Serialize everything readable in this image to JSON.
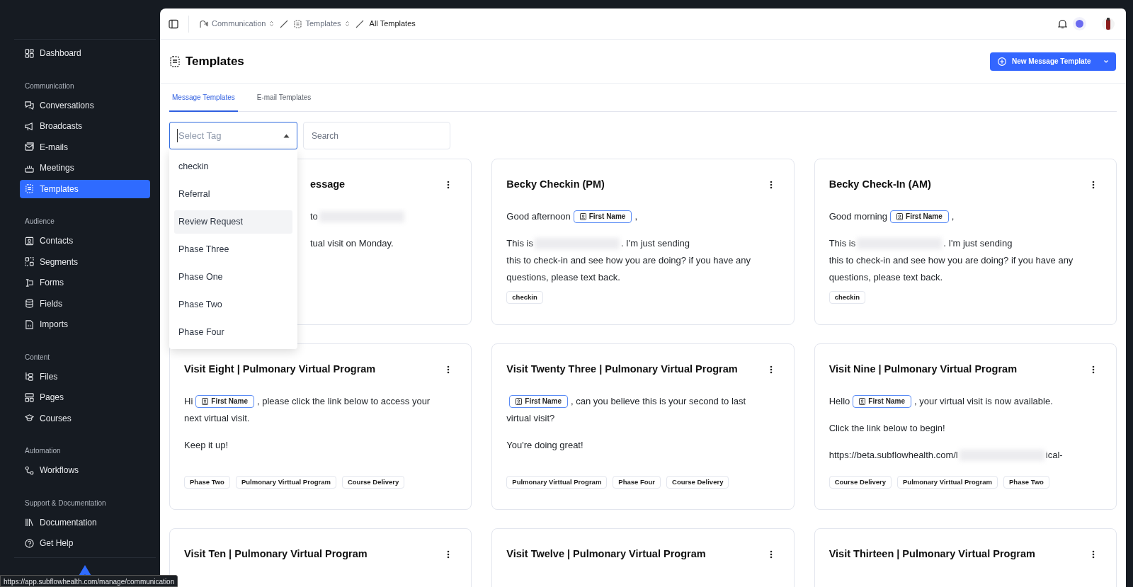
{
  "sidebar": {
    "sections": [
      {
        "items": [
          {
            "label": "Dashboard",
            "selected": false
          }
        ]
      },
      {
        "heading": "Communication",
        "items": [
          {
            "label": "Conversations",
            "selected": false
          },
          {
            "label": "Broadcasts",
            "selected": false
          },
          {
            "label": "E-mails",
            "selected": false
          },
          {
            "label": "Meetings",
            "selected": false
          },
          {
            "label": "Templates",
            "selected": true
          }
        ]
      },
      {
        "heading": "Audience",
        "items": [
          {
            "label": "Contacts",
            "selected": false
          },
          {
            "label": "Segments",
            "selected": false
          },
          {
            "label": "Forms",
            "selected": false
          },
          {
            "label": "Fields",
            "selected": false
          },
          {
            "label": "Imports",
            "selected": false
          }
        ]
      },
      {
        "heading": "Content",
        "items": [
          {
            "label": "Files",
            "selected": false
          },
          {
            "label": "Pages",
            "selected": false
          },
          {
            "label": "Courses",
            "selected": false
          }
        ]
      },
      {
        "heading": "Automation",
        "items": [
          {
            "label": "Workflows",
            "selected": false
          }
        ]
      },
      {
        "heading": "Support & Documentation",
        "items": [
          {
            "label": "Documentation",
            "selected": false
          },
          {
            "label": "Get Help",
            "selected": false
          }
        ]
      }
    ]
  },
  "breadcrumbs": [
    {
      "label": "Communication",
      "kind": "menu"
    },
    {
      "label": "Templates",
      "kind": "menu"
    },
    {
      "label": "All Templates",
      "kind": "current"
    }
  ],
  "page": {
    "title": "Templates",
    "new_button": "New Message Template"
  },
  "tabs": [
    {
      "label": "Message Templates",
      "selected": true
    },
    {
      "label": "E-mail Templates",
      "selected": false
    }
  ],
  "filters": {
    "tag_placeholder": "Select Tag",
    "search_placeholder": "Search"
  },
  "tag_options": [
    {
      "label": "checkin",
      "highlighted": false
    },
    {
      "label": "Referral",
      "highlighted": false
    },
    {
      "label": "Review Request",
      "highlighted": true
    },
    {
      "label": "Phase Three",
      "highlighted": false
    },
    {
      "label": "Phase One",
      "highlighted": false
    },
    {
      "label": "Phase Two",
      "highlighted": false
    },
    {
      "label": "Phase Four",
      "highlighted": false
    }
  ],
  "cards": [
    {
      "title": "essage",
      "covered": true,
      "paragraphs": [
        [
          [
            {
              "kind": "text",
              "text": "to"
            },
            {
              "kind": "redacted"
            }
          ]
        ],
        [
          [
            {
              "kind": "text",
              "text": "tual visit on Monday."
            }
          ]
        ]
      ]
    },
    {
      "title": "Becky Checkin (PM)",
      "paragraphs": [
        [
          [
            {
              "kind": "text",
              "text": "Good afternoon"
            },
            {
              "kind": "chip",
              "text": "First Name"
            },
            {
              "kind": "text",
              "text": ","
            }
          ]
        ],
        [
          [
            {
              "kind": "text",
              "text": "This is"
            },
            {
              "kind": "redacted"
            },
            {
              "kind": "text",
              "text": ". I'm just sending"
            }
          ],
          [
            {
              "kind": "text",
              "text": "this to check-in and see how you are doing? if you have any"
            }
          ],
          [
            {
              "kind": "text",
              "text": "questions, please text back."
            }
          ]
        ]
      ],
      "tags": [
        "checkin"
      ]
    },
    {
      "title": "Becky Check-In (AM)",
      "paragraphs": [
        [
          [
            {
              "kind": "text",
              "text": "Good morning"
            },
            {
              "kind": "chip",
              "text": "First Name"
            },
            {
              "kind": "text",
              "text": ","
            }
          ]
        ],
        [
          [
            {
              "kind": "text",
              "text": "This is"
            },
            {
              "kind": "redacted"
            },
            {
              "kind": "text",
              "text": ". I'm just sending"
            }
          ],
          [
            {
              "kind": "text",
              "text": "this to check-in and see how you are doing? if you have any"
            }
          ],
          [
            {
              "kind": "text",
              "text": "questions, please text back."
            }
          ]
        ]
      ],
      "tags": [
        "checkin"
      ]
    },
    {
      "title": "Visit Eight | Pulmonary Virtual Program",
      "paragraphs": [
        [
          [
            {
              "kind": "text",
              "text": "Hi"
            },
            {
              "kind": "chip",
              "text": "First Name"
            },
            {
              "kind": "text",
              "text": ", please click the link below to access your"
            }
          ],
          [
            {
              "kind": "text",
              "text": "next virtual visit."
            }
          ]
        ],
        [
          [
            {
              "kind": "text",
              "text": "Keep it up!"
            }
          ]
        ]
      ],
      "tags": [
        "Phase Two",
        "Pulmonary Virttual Program",
        "Course Delivery"
      ]
    },
    {
      "title": "Visit Twenty Three | Pulmonary Virtual Program",
      "paragraphs": [
        [
          [
            {
              "kind": "chip",
              "text": "First Name"
            },
            {
              "kind": "text",
              "text": ", can you believe this is your second to last"
            }
          ],
          [
            {
              "kind": "text",
              "text": "virtual visit?"
            }
          ]
        ],
        [
          [
            {
              "kind": "text",
              "text": "You're doing great!"
            }
          ]
        ]
      ],
      "tags": [
        "Pulmonary Virttual Program",
        "Phase Four",
        "Course Delivery"
      ]
    },
    {
      "title": "Visit Nine | Pulmonary Virtual Program",
      "paragraphs": [
        [
          [
            {
              "kind": "text",
              "text": "Hello"
            },
            {
              "kind": "chip",
              "text": "First Name"
            },
            {
              "kind": "text",
              "text": ",  your virtual visit is now available."
            }
          ]
        ],
        [
          [
            {
              "kind": "text",
              "text": "Click the link below to begin!"
            }
          ]
        ],
        [
          [
            {
              "kind": "text",
              "text": "https://beta.subflowhealth.com/l"
            },
            {
              "kind": "redacted"
            },
            {
              "kind": "text",
              "text": "ical-"
            }
          ]
        ]
      ],
      "tags": [
        "Course Delivery",
        "Pulmonary Virttual Program",
        "Phase Two"
      ]
    },
    {
      "title": "Visit Ten | Pulmonary Virtual Program"
    },
    {
      "title": "Visit Twelve | Pulmonary Virtual Program"
    },
    {
      "title": "Visit Thirteen | Pulmonary Virtual Program"
    }
  ],
  "status_url": "https://app.subflowhealth.com/manage/communication"
}
